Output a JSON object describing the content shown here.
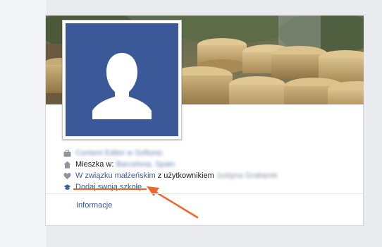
{
  "profile": {
    "cover_alt": "cover photo",
    "avatar_alt": "default profile silhouette"
  },
  "intro": {
    "work": {
      "text": "Content Editor w Softonic"
    },
    "lives": {
      "prefix": "Mieszka w:",
      "place": "Barcelona, Spain"
    },
    "relationship": {
      "status": "W związku małżeńskim",
      "connector": " z użytkownikiem ",
      "partner": "Justyna Grabarek"
    },
    "school": {
      "text": "Dodaj swoją szkołę"
    },
    "info_link": "Informacje"
  },
  "colors": {
    "brand": "#3b5998",
    "highlight": "#f1642a"
  },
  "icons": [
    "briefcase-icon",
    "home-icon",
    "heart-icon",
    "graduation-cap-icon"
  ]
}
